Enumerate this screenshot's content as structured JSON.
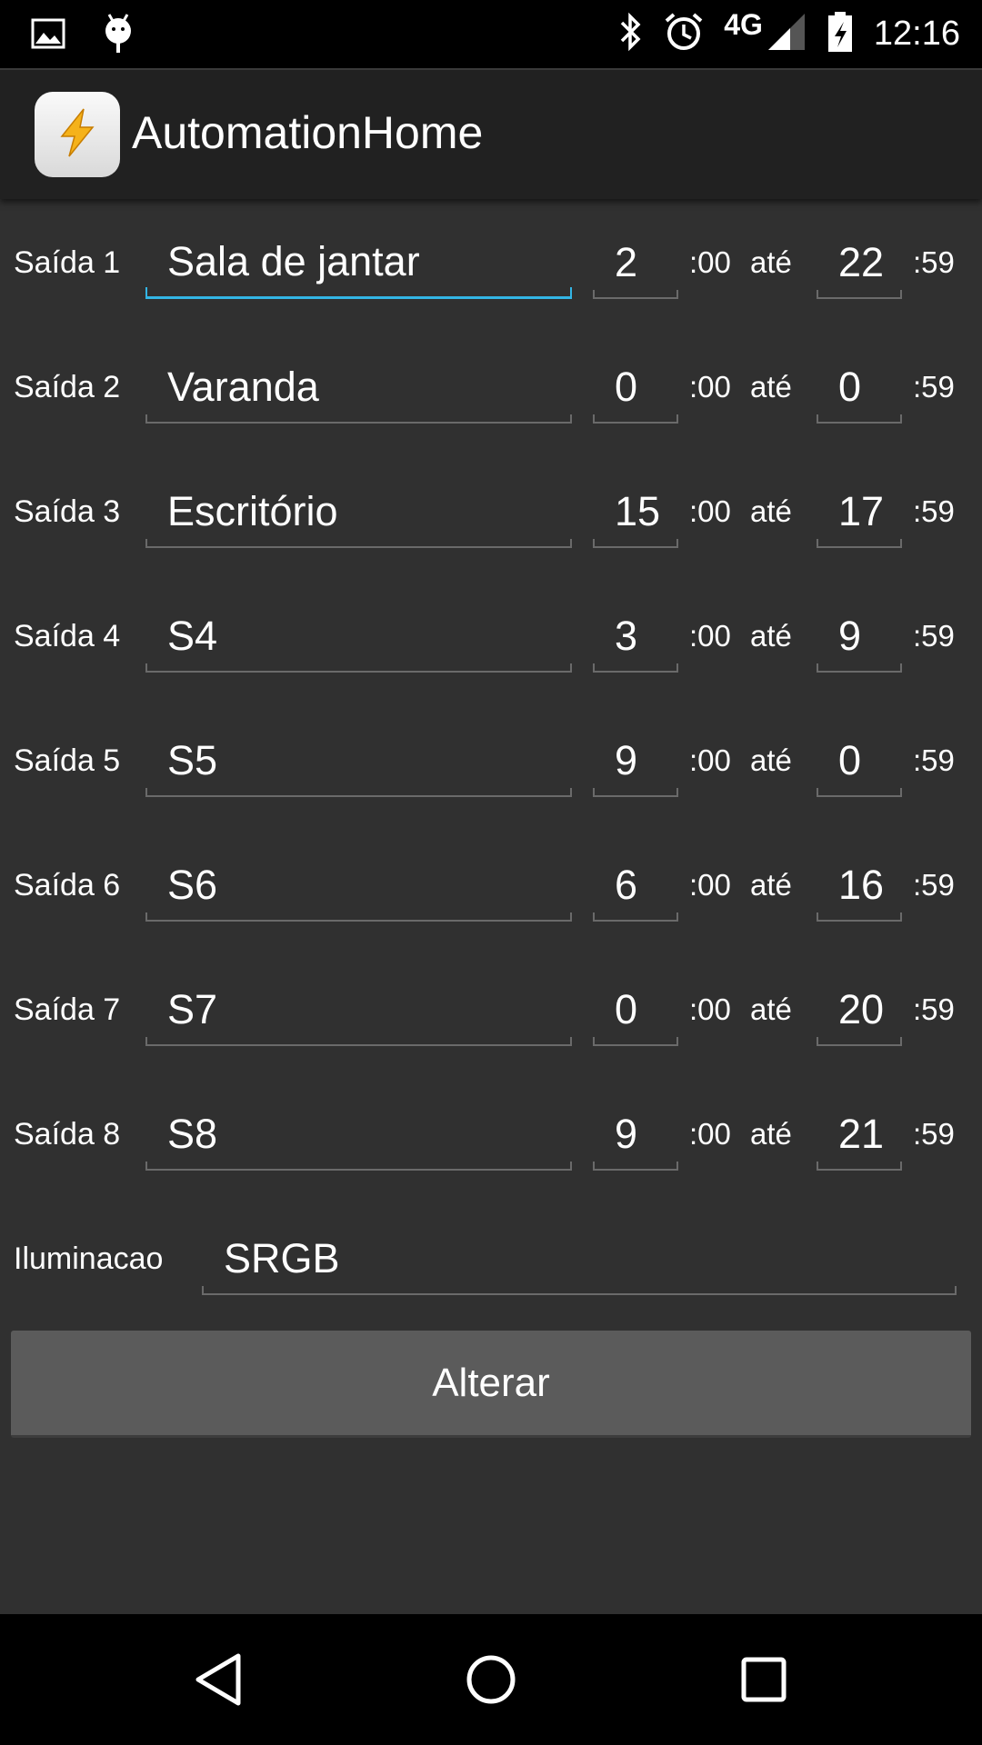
{
  "status_bar": {
    "time": "12:16",
    "network": "4G",
    "icons": [
      "image-icon",
      "android-icon",
      "bluetooth-icon",
      "alarm-icon",
      "signal-icon",
      "battery-icon"
    ]
  },
  "app_bar": {
    "title": "AutomationHome",
    "icon": "lightning-icon"
  },
  "outputs": [
    {
      "label": "Saída 1",
      "name": "Sala de jantar",
      "start": "2",
      "start_suffix": ":00",
      "until": "até",
      "end": "22",
      "end_suffix": ":59"
    },
    {
      "label": "Saída 2",
      "name": "Varanda",
      "start": "0",
      "start_suffix": ":00",
      "until": "até",
      "end": "0",
      "end_suffix": ":59"
    },
    {
      "label": "Saída 3",
      "name": "Escritório",
      "start": "15",
      "start_suffix": ":00",
      "until": "até",
      "end": "17",
      "end_suffix": ":59"
    },
    {
      "label": "Saída 4",
      "name": "S4",
      "start": "3",
      "start_suffix": ":00",
      "until": "até",
      "end": "9",
      "end_suffix": ":59"
    },
    {
      "label": "Saída 5",
      "name": "S5",
      "start": "9",
      "start_suffix": ":00",
      "until": "até",
      "end": "0",
      "end_suffix": ":59"
    },
    {
      "label": "Saída 6",
      "name": "S6",
      "start": "6",
      "start_suffix": ":00",
      "until": "até",
      "end": "16",
      "end_suffix": ":59"
    },
    {
      "label": "Saída 7",
      "name": "S7",
      "start": "0",
      "start_suffix": ":00",
      "until": "até",
      "end": "20",
      "end_suffix": ":59"
    },
    {
      "label": "Saída 8",
      "name": "S8",
      "start": "9",
      "start_suffix": ":00",
      "until": "até",
      "end": "21",
      "end_suffix": ":59"
    }
  ],
  "lighting": {
    "label": "Iluminacao",
    "value": "SRGB"
  },
  "submit_button": "Alterar",
  "nav_bar": {
    "icons": [
      "back-icon",
      "home-icon",
      "recents-icon"
    ]
  },
  "colors": {
    "accent": "#33b5e5",
    "background": "#303030",
    "action_bar": "#212121",
    "button": "#5b5b5b"
  }
}
